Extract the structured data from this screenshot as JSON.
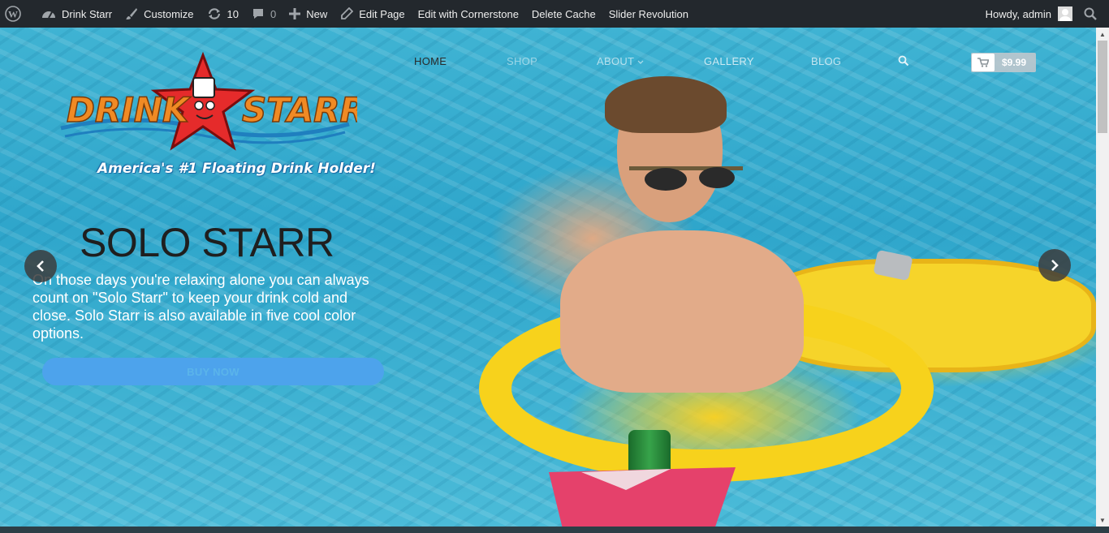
{
  "adminbar": {
    "site_name": "Drink Starr",
    "customize": "Customize",
    "updates_count": "10",
    "comments_count": "0",
    "new": "New",
    "edit_page": "Edit Page",
    "edit_cornerstone": "Edit with Cornerstone",
    "delete_cache": "Delete Cache",
    "slider_revolution": "Slider Revolution",
    "howdy": "Howdy, admin"
  },
  "logo": {
    "word1": "DRINK",
    "word2": "STARR",
    "tagline": "America's #1 Floating Drink Holder!"
  },
  "nav": {
    "items": [
      "HOME",
      "SHOP",
      "ABOUT",
      "GALLERY",
      "BLOG"
    ],
    "active": "HOME",
    "cart_total": "$9.99"
  },
  "slide": {
    "title": "SOLO STARR",
    "description": "On those days you're relaxing alone you can always count on \"Solo Starr\" to keep your drink cold and close. Solo Starr is also available in five cool color options.",
    "button": "BUY NOW"
  },
  "colors": {
    "adminbar_bg": "#23282d",
    "pool": "#2fa6cb",
    "button": "#4da3ec",
    "logo_orange": "#f08a24",
    "star_red": "#e52b2b"
  }
}
